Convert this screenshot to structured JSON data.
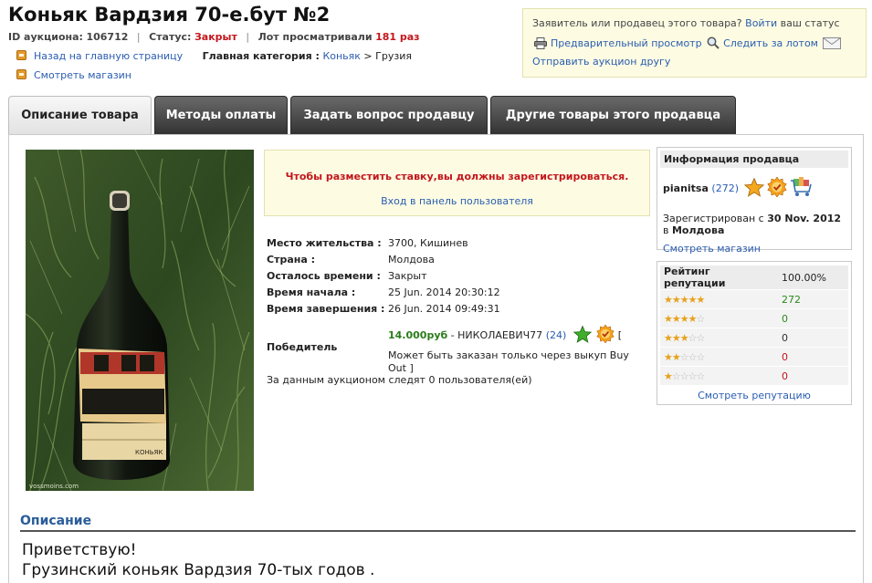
{
  "title": "Коньяк Вардзия 70-е.бут №2",
  "meta": {
    "id_label": "ID аукциона:",
    "id_value": "106712",
    "status_label": "Статус:",
    "status_value": "Закрыт",
    "views_label": "Лот просматривали",
    "views_value": "181 раз"
  },
  "nav": {
    "back_link": "Назад на главную страницу",
    "category_label": "Главная категория :",
    "category_link": "Коньяк",
    "category_sep": " > ",
    "subcategory": "Грузия",
    "shop_link": "Смотреть магазин"
  },
  "notice": {
    "text_before": "Заявитель или продавец этого товара?",
    "login_link": "Войти",
    "text_after": "ваш статус",
    "preview_link": "Предварительный просмотр",
    "watch_link": "Следить за лотом",
    "send_friend_link": "Отправить аукцион другу"
  },
  "tabs": [
    {
      "label": "Описание товара",
      "active": true
    },
    {
      "label": "Методы оплаты",
      "active": false
    },
    {
      "label": "Задать вопрос продавцу",
      "active": false
    },
    {
      "label": "Другие товары этого продавца",
      "active": false
    }
  ],
  "bid_box": {
    "warning": "Чтобы разместить ставку,вы должны зарегистрироваться.",
    "login_link": "Вход в панель пользователя"
  },
  "details": {
    "location_label": "Место жительства :",
    "location_value": "3700, Кишинев",
    "country_label": "Страна :",
    "country_value": "Молдова",
    "time_left_label": "Осталось времени :",
    "time_left_value": "Закрыт",
    "start_label": "Время начала :",
    "start_value": "25 Jun. 2014 20:30:12",
    "end_label": "Время завершения :",
    "end_value": "26 Jun. 2014 09:49:31",
    "winner_label": "Победитель",
    "winner_price": "14.000руб",
    "winner_name": " - НИКОЛАЕВИЧ77 ",
    "winner_rating": "(24)",
    "winner_bracket": " [",
    "winner_note": "Может быть заказан только через выкуп Buy Out ]",
    "watchers": "За данным аукционом следят 0 пользователя(ей)"
  },
  "seller": {
    "heading": "Информация продавца",
    "name": "pianitsa",
    "rating": "(272)",
    "registered_prefix": "Зарегистрирован с",
    "registered_date": "30 Nov. 2012",
    "registered_in": "в",
    "registered_country": "Молдова",
    "shop_link": "Смотреть магазин"
  },
  "reputation": {
    "heading": "Рейтинг репутации",
    "percent": "100.00%",
    "rows": [
      {
        "stars": 5,
        "count": "272"
      },
      {
        "stars": 4,
        "count": "0"
      },
      {
        "stars": 3,
        "count": "0"
      },
      {
        "stars": 2,
        "count": "0"
      },
      {
        "stars": 1,
        "count": "0"
      }
    ],
    "more_link": "Смотреть репутацию"
  },
  "description": {
    "heading": "Описание",
    "line1": "Приветствую!",
    "line2": "Грузинский коньяк Вардзия 70-тых годов ."
  },
  "photo": {
    "watermark": "vossmoins.com",
    "label_text": "КОНЬЯК"
  },
  "colors": {
    "link": "#2a5db0",
    "status_red": "#c3161c",
    "price_green": "#2a7d1a",
    "notice_bg": "#fdfce3",
    "tab_dark": "#333333",
    "star_gold": "#e7a21c"
  }
}
